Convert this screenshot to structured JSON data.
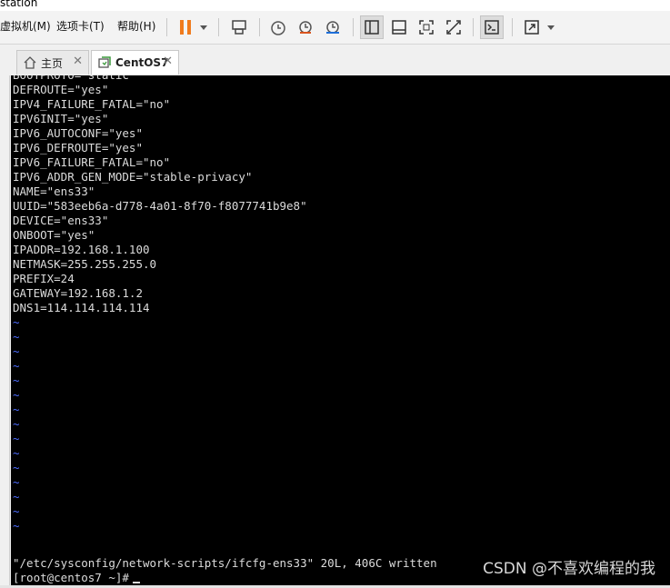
{
  "window": {
    "title_fragment": "station"
  },
  "menu": [
    "虚拟机(M)",
    "选项卡(T)",
    "帮助(H)"
  ],
  "tabs": [
    {
      "label": "主页",
      "icon": "home-icon"
    },
    {
      "label": "CentOS7",
      "icon": "vm-icon"
    }
  ],
  "terminal": {
    "lines": [
      "BOOTPROTO=\"static\"",
      "DEFROUTE=\"yes\"",
      "IPV4_FAILURE_FATAL=\"no\"",
      "IPV6INIT=\"yes\"",
      "IPV6_AUTOCONF=\"yes\"",
      "IPV6_DEFROUTE=\"yes\"",
      "IPV6_FAILURE_FATAL=\"no\"",
      "IPV6_ADDR_GEN_MODE=\"stable-privacy\"",
      "NAME=\"ens33\"",
      "UUID=\"583eeb6a-d778-4a01-8f70-f8077741b9e8\"",
      "DEVICE=\"ens33\"",
      "ONBOOT=\"yes\"",
      "IPADDR=192.168.1.100",
      "NETMASK=255.255.255.0",
      "PREFIX=24",
      "GATEWAY=192.168.1.2",
      "DNS1=114.114.114.114"
    ],
    "tilde": "~",
    "tilde_count": 15,
    "status_line": "\"/etc/sysconfig/network-scripts/ifcfg-ens33\" 20L, 406C written",
    "prompt": "[root@centos7 ~]#"
  },
  "watermark": "CSDN @不喜欢编程的我",
  "colors": {
    "terminal_bg": "#000000",
    "terminal_fg": "#dcdcdc",
    "tilde": "#4d6cff",
    "pause": "#f07b1d"
  }
}
